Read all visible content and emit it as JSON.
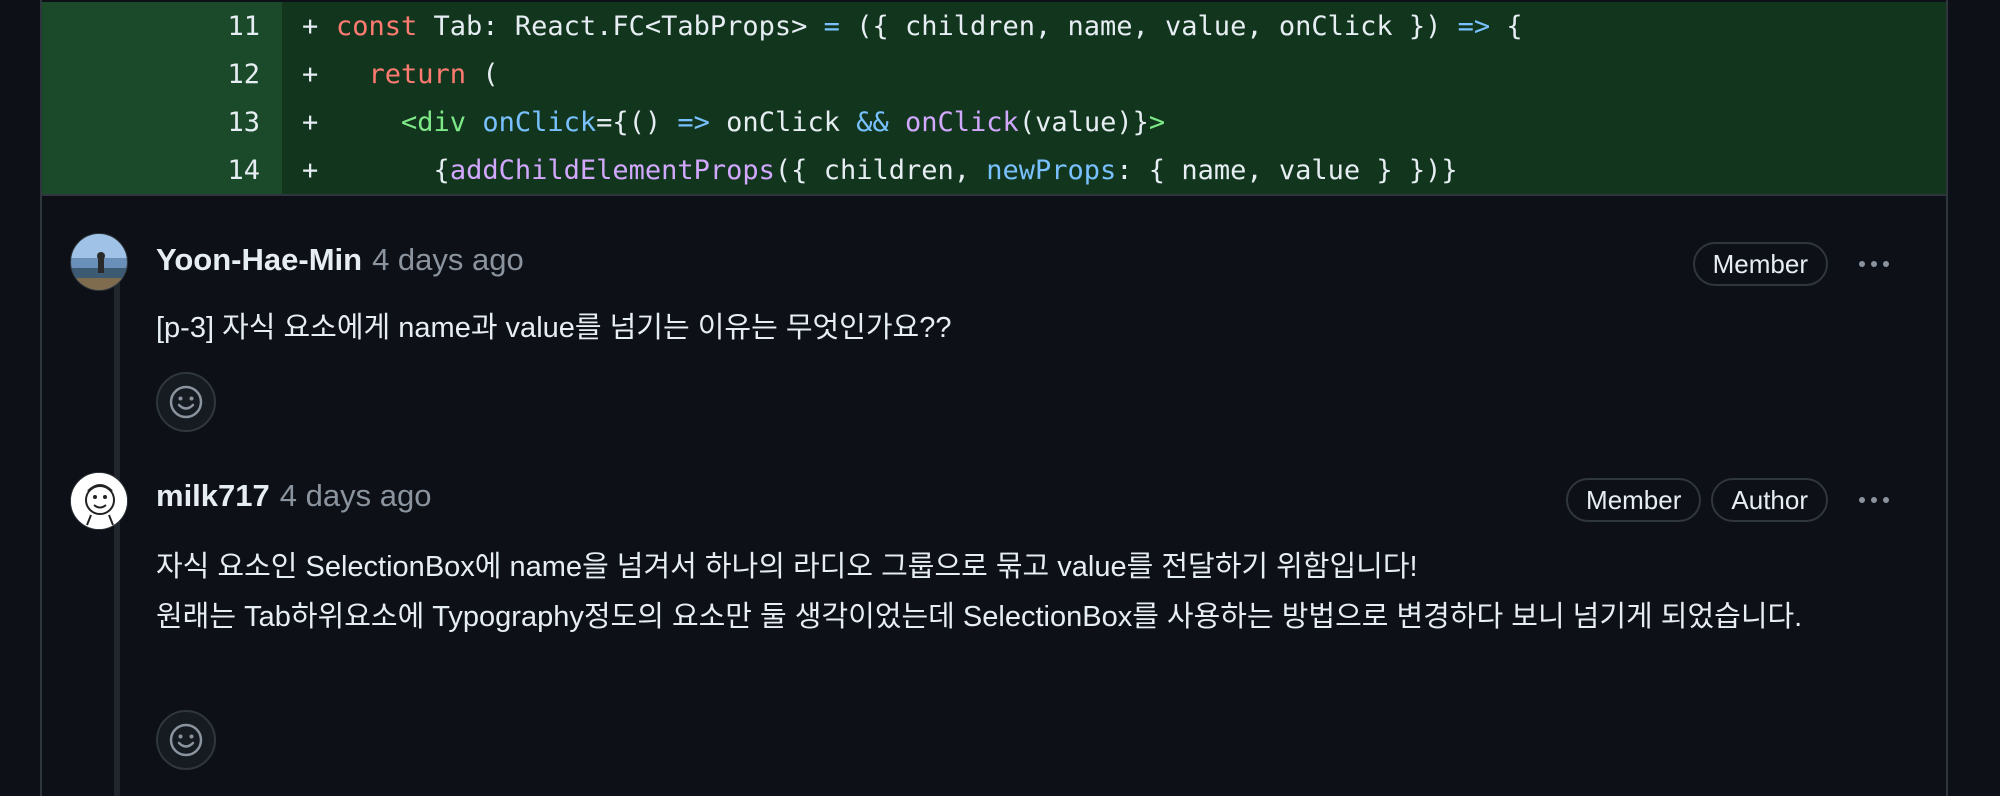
{
  "diff": {
    "lines": [
      {
        "number": "11",
        "marker": "+"
      },
      {
        "number": "12",
        "marker": "+"
      },
      {
        "number": "13",
        "marker": "+"
      },
      {
        "number": "14",
        "marker": "+"
      }
    ],
    "code": {
      "line11": {
        "kw_const": "const",
        "t1": " Tab: React.FC<TabProps> ",
        "op_eq": "=",
        "t2": " ({ children, name, value, onClick }) ",
        "op_arrow": "=>",
        "t3": " {"
      },
      "line12": {
        "indent": "  ",
        "kw_return": "return",
        "t1": " ("
      },
      "line13": {
        "indent": "    ",
        "tag_open": "<div",
        "sp": " ",
        "attr": "onClick",
        "t1": "={() ",
        "op_arrow": "=>",
        "t2": " onClick ",
        "op_and": "&&",
        "sp2": " ",
        "fn_onclick": "onClick",
        "t3": "(value)}",
        "tag_close": ">"
      },
      "line14": {
        "indent": "      ",
        "t1": "{",
        "fn_add": "addChildElementProps",
        "t2": "({ children, ",
        "attr_newprops": "newProps",
        "t3": ": { name, value } })}"
      }
    }
  },
  "comments": [
    {
      "author": "Yoon-Hae-Min",
      "time": "4 days ago",
      "badges": [
        "Member"
      ],
      "body": [
        "[p-3] 자식 요소에게 name과 value를 넘기는 이유는 무엇인가요??"
      ]
    },
    {
      "author": "milk717",
      "time": "4 days ago",
      "badges": [
        "Member",
        "Author"
      ],
      "body": [
        "자식 요소인 SelectionBox에 name을 넘겨서 하나의 라디오 그룹으로 묶고 value를 전달하기 위함입니다!",
        "원래는 Tab하위요소에 Typography정도의 요소만 둘 생각이었는데 SelectionBox를 사용하는 방법으로 변경하다 보니 넘기게 되었습니다."
      ]
    }
  ],
  "icons": {
    "more": "kebab-horizontal-icon",
    "reaction": "smiley-icon"
  },
  "colors": {
    "background": "#0d1117",
    "diff_addition_code": "#12361d",
    "diff_addition_number": "#1a4a2a",
    "keyword": "#ff7b72",
    "function": "#d2a8ff",
    "tag": "#7ee787",
    "attribute": "#79c0ff",
    "muted": "#8b949e"
  }
}
